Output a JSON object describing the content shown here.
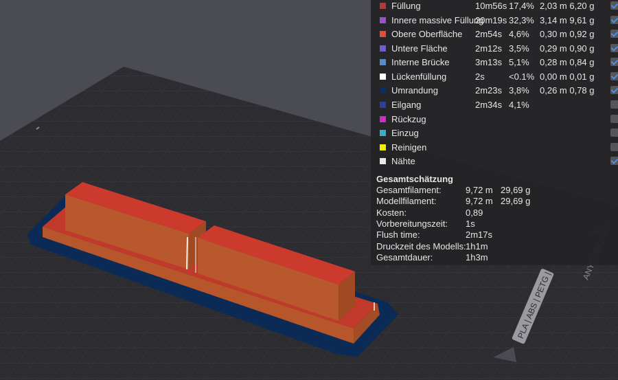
{
  "legend": {
    "rows": [
      {
        "name": "Füllung",
        "time": "10m56s",
        "percent": "17,4%",
        "usage": "2,03 m 6,20 g",
        "color": "#b03a3a",
        "visible": true
      },
      {
        "name": "Innere massive Füllung",
        "time": "20m19s",
        "percent": "32,3%",
        "usage": "3,14 m 9,61 g",
        "color": "#9a4fd0",
        "visible": true
      },
      {
        "name": "Obere Oberfläche",
        "time": "2m54s",
        "percent": "4,6%",
        "usage": "0,30 m 0,92 g",
        "color": "#e84a3a",
        "visible": true
      },
      {
        "name": "Untere Fläche",
        "time": "2m12s",
        "percent": "3,5%",
        "usage": "0,29 m 0,90 g",
        "color": "#6a5ed0",
        "visible": true
      },
      {
        "name": "Interne Brücke",
        "time": "3m13s",
        "percent": "5,1%",
        "usage": "0,28 m 0,84 g",
        "color": "#5a88c8",
        "visible": true
      },
      {
        "name": "Lückenfüllung",
        "time": "2s",
        "percent": "<0.1%",
        "usage": "0,00 m 0,01 g",
        "color": "#ffffff",
        "visible": true
      },
      {
        "name": "Umrandung",
        "time": "2m23s",
        "percent": "3,8%",
        "usage": "0,26 m 0,78 g",
        "color": "#0c2f63",
        "visible": true
      },
      {
        "name": "Eilgang",
        "time": "2m34s",
        "percent": "4,1%",
        "usage": "",
        "color": "#2f3f96",
        "visible": false
      },
      {
        "name": "Rückzug",
        "time": "",
        "percent": "",
        "usage": "",
        "color": "#d32cc6",
        "visible": false
      },
      {
        "name": "Einzug",
        "time": "",
        "percent": "",
        "usage": "",
        "color": "#34b0c8",
        "visible": false
      },
      {
        "name": "Reinigen",
        "time": "",
        "percent": "",
        "usage": "",
        "color": "#f0f000",
        "visible": false
      },
      {
        "name": "Nähte",
        "time": "",
        "percent": "",
        "usage": "",
        "color": "#e8e8e8",
        "visible": true
      }
    ]
  },
  "summary": {
    "title": "Gesamtschätzung",
    "rows": [
      {
        "label": "Gesamtfilament:",
        "value": "9,72 m",
        "value2": "29,69 g"
      },
      {
        "label": "Modellfilament:",
        "value": "9,72 m",
        "value2": "29,69 g"
      },
      {
        "label": "Kosten:",
        "value": "0,89",
        "value2": ""
      },
      {
        "label": "Vorbereitungszeit:",
        "value": "1s",
        "value2": ""
      },
      {
        "label": "Flush time:",
        "value": "2m17s",
        "value2": ""
      },
      {
        "label": "Druckzeit des Modells:",
        "value": "1h1m",
        "value2": ""
      },
      {
        "label": "Gesamtdauer:",
        "value": "1h3m",
        "value2": ""
      }
    ]
  },
  "plate": {
    "label_material": "PLA | ABS | PETG | ASA",
    "label_brand": "ANYCUBIC"
  }
}
